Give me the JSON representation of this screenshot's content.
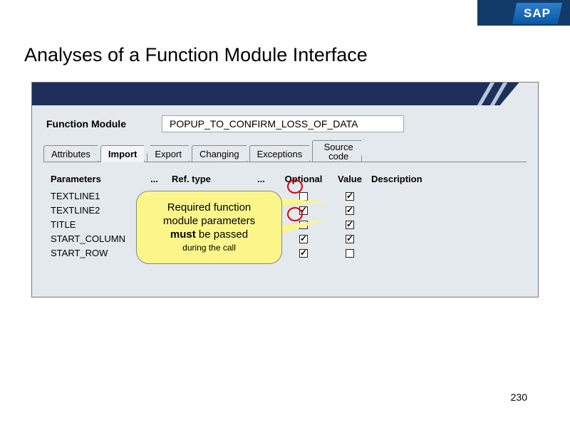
{
  "brand": "SAP",
  "title": "Analyses of a Function Module Interface",
  "fm": {
    "label": "Function Module",
    "value": "POPUP_TO_CONFIRM_LOSS_OF_DATA"
  },
  "tabs": {
    "attributes": "Attributes",
    "import": "Import",
    "export": "Export",
    "changing": "Changing",
    "exceptions": "Exceptions",
    "source_code": "Source code"
  },
  "columns": {
    "parameters": "Parameters",
    "dots1": "...",
    "ref_type": "Ref. type",
    "dots2": "...",
    "optional": "Optional",
    "value": "Value",
    "description": "Description"
  },
  "rows": [
    {
      "name": "TEXTLINE1",
      "optional": false,
      "value": true
    },
    {
      "name": "TEXTLINE2",
      "optional": true,
      "value": true
    },
    {
      "name": "TITLE",
      "optional": false,
      "value": true
    },
    {
      "name": "START_COLUMN",
      "optional": true,
      "value": true
    },
    {
      "name": "START_ROW",
      "optional": true,
      "value": false
    }
  ],
  "callout": {
    "line1": "Required function",
    "line2": "module parameters",
    "line3a": "must",
    "line3b": " be passed",
    "line4": "during the call"
  },
  "page_number": "230"
}
